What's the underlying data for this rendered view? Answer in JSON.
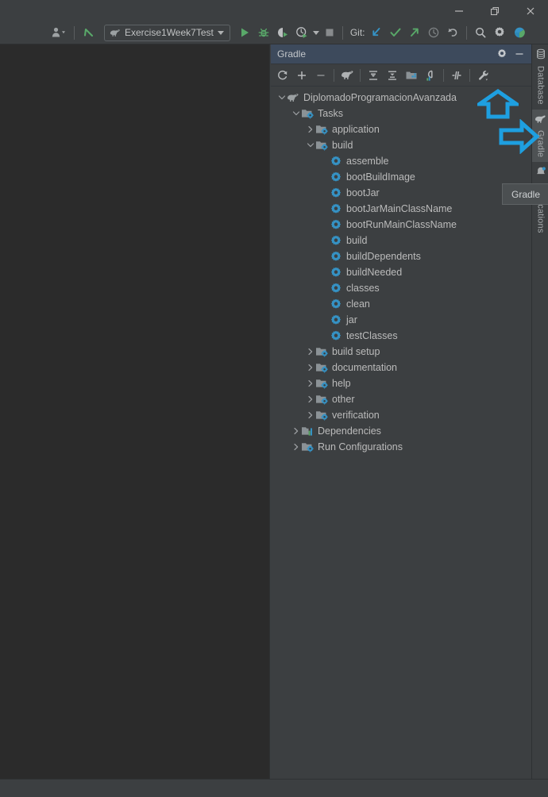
{
  "window": {
    "controls": [
      {
        "name": "minimize",
        "glyph": "minimize-icon"
      },
      {
        "name": "maximize",
        "glyph": "maximize-icon"
      },
      {
        "name": "close",
        "glyph": "close-icon"
      }
    ]
  },
  "toolbar": {
    "user_icon": "user-icon",
    "update_icon": "update-project-icon",
    "run_config": {
      "label": "Exercise1Week7Test",
      "icon": "gradle-elephant-icon"
    },
    "run_label": "run-icon",
    "debug_label": "debug-icon",
    "run_coverage_label": "run-with-coverage-icon",
    "profile_label": "profiler-icon",
    "stop_label": "stop-icon",
    "git_label": "Git:",
    "git_update_icon": "update-arrow-icon",
    "git_commit_icon": "commit-check-icon",
    "git_push_icon": "push-arrow-icon",
    "git_history_icon": "history-clock-icon",
    "git_rollback_icon": "rollback-icon",
    "search_icon": "search-icon",
    "settings_icon": "gear-icon",
    "ide_icon": "ide-logo-icon"
  },
  "tool_window": {
    "title": "Gradle",
    "header_buttons": [
      {
        "name": "settings-button",
        "icon": "gear-icon"
      },
      {
        "name": "hide-button",
        "icon": "minimize-icon"
      }
    ],
    "toolbar_buttons": [
      {
        "name": "reload-all-gradle-projects",
        "icon": "refresh-icon"
      },
      {
        "name": "link-gradle-project",
        "icon": "plus-icon"
      },
      {
        "name": "detach-external-project",
        "icon": "minus-icon"
      },
      {
        "name": "execute-gradle-task",
        "icon": "gradle-elephant-icon"
      },
      {
        "name": "expand-all",
        "icon": "expand-all-icon"
      },
      {
        "name": "collapse-all",
        "icon": "collapse-all-icon"
      },
      {
        "name": "toggle-offline-mode",
        "icon": "project-folder-icon"
      },
      {
        "name": "show-dependencies-analyzer",
        "icon": "analyzer-icon"
      },
      {
        "name": "toggle-tasks-grouping",
        "icon": "filter-icon"
      },
      {
        "name": "build-tool-settings",
        "icon": "wrench-icon"
      }
    ]
  },
  "tree": {
    "nodes": [
      {
        "label": "DiplomadoProgramacionAvanzada",
        "depth": 0,
        "chevron": "down",
        "icon": "gradle-elephant-icon"
      },
      {
        "label": "Tasks",
        "depth": 1,
        "chevron": "down",
        "icon": "task-folder-icon"
      },
      {
        "label": "application",
        "depth": 2,
        "chevron": "right",
        "icon": "task-folder-icon"
      },
      {
        "label": "build",
        "depth": 2,
        "chevron": "down",
        "icon": "task-folder-icon"
      },
      {
        "label": "assemble",
        "depth": 3,
        "chevron": "none",
        "icon": "gear-task-icon"
      },
      {
        "label": "bootBuildImage",
        "depth": 3,
        "chevron": "none",
        "icon": "gear-task-icon"
      },
      {
        "label": "bootJar",
        "depth": 3,
        "chevron": "none",
        "icon": "gear-task-icon"
      },
      {
        "label": "bootJarMainClassName",
        "depth": 3,
        "chevron": "none",
        "icon": "gear-task-icon"
      },
      {
        "label": "bootRunMainClassName",
        "depth": 3,
        "chevron": "none",
        "icon": "gear-task-icon"
      },
      {
        "label": "build",
        "depth": 3,
        "chevron": "none",
        "icon": "gear-task-icon"
      },
      {
        "label": "buildDependents",
        "depth": 3,
        "chevron": "none",
        "icon": "gear-task-icon"
      },
      {
        "label": "buildNeeded",
        "depth": 3,
        "chevron": "none",
        "icon": "gear-task-icon"
      },
      {
        "label": "classes",
        "depth": 3,
        "chevron": "none",
        "icon": "gear-task-icon"
      },
      {
        "label": "clean",
        "depth": 3,
        "chevron": "none",
        "icon": "gear-task-icon"
      },
      {
        "label": "jar",
        "depth": 3,
        "chevron": "none",
        "icon": "gear-task-icon"
      },
      {
        "label": "testClasses",
        "depth": 3,
        "chevron": "none",
        "icon": "gear-task-icon"
      },
      {
        "label": "build setup",
        "depth": 2,
        "chevron": "right",
        "icon": "task-folder-icon"
      },
      {
        "label": "documentation",
        "depth": 2,
        "chevron": "right",
        "icon": "task-folder-icon"
      },
      {
        "label": "help",
        "depth": 2,
        "chevron": "right",
        "icon": "task-folder-icon"
      },
      {
        "label": "other",
        "depth": 2,
        "chevron": "right",
        "icon": "task-folder-icon"
      },
      {
        "label": "verification",
        "depth": 2,
        "chevron": "right",
        "icon": "task-folder-icon"
      },
      {
        "label": "Dependencies",
        "depth": 1,
        "chevron": "right",
        "icon": "dependencies-icon"
      },
      {
        "label": "Run Configurations",
        "depth": 1,
        "chevron": "right",
        "icon": "task-folder-icon"
      }
    ]
  },
  "stripe": {
    "items": [
      {
        "label": "Database",
        "icon": "database-icon",
        "active": false
      },
      {
        "label": "Gradle",
        "icon": "gradle-elephant-icon",
        "active": true
      },
      {
        "label": "Notifications",
        "icon": "notifications-icon",
        "active": false
      }
    ]
  },
  "tooltip": {
    "text": "Gradle"
  },
  "annotations": {
    "color": "#1e9fe0",
    "arrows": [
      {
        "name": "up-arrow-annotation",
        "direction": "up"
      },
      {
        "name": "right-arrow-annotation",
        "direction": "right"
      }
    ]
  },
  "colors": {
    "accent_blue": "#1e9fe0",
    "panel_bg": "#3c3f41",
    "editor_bg": "#2b2b2b",
    "header_bg": "#3d4a5c",
    "text": "#bbbbbb",
    "green": "#59a869",
    "blue_icon": "#3592c4"
  }
}
